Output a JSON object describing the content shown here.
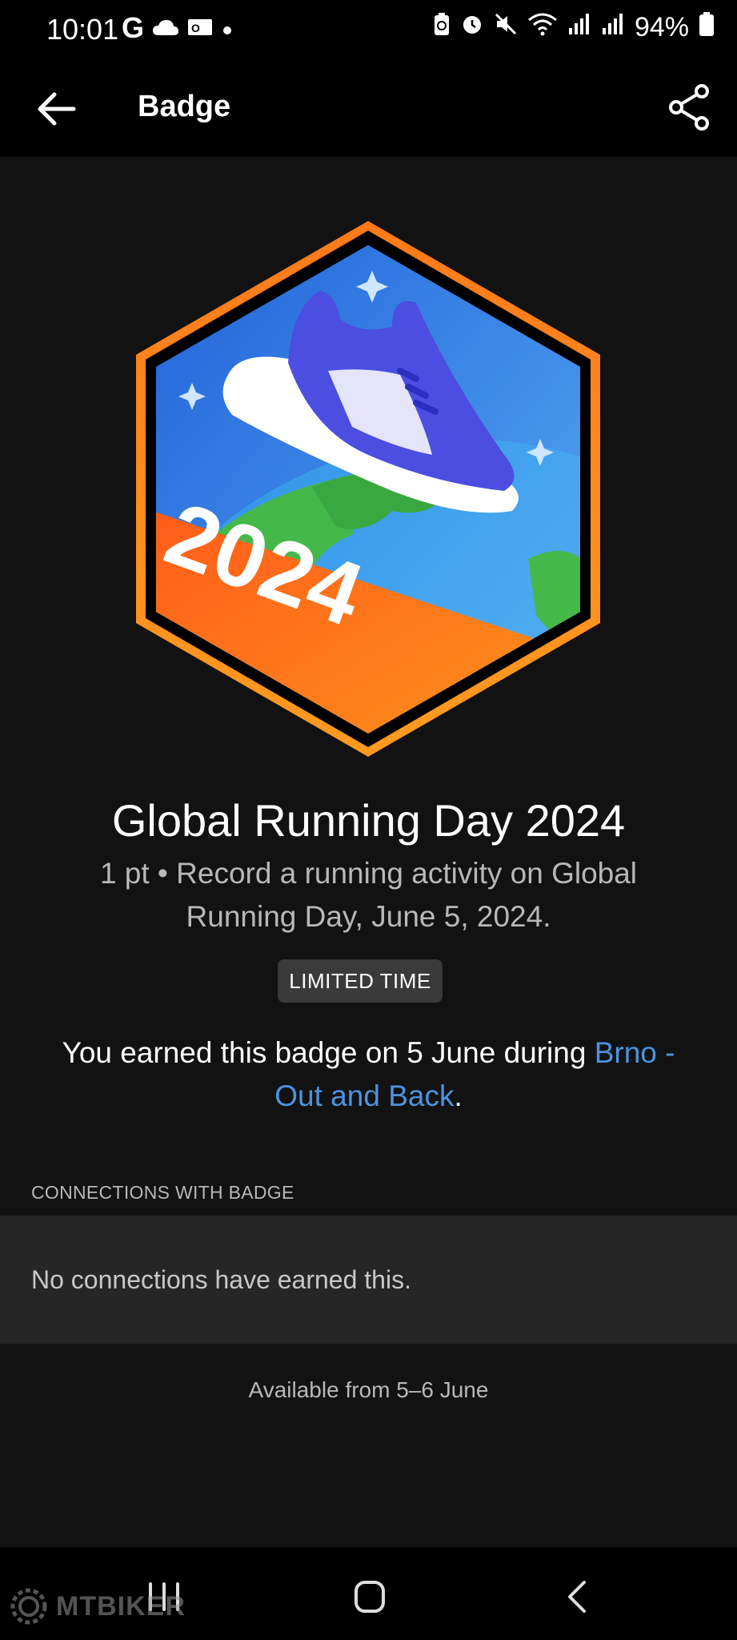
{
  "status_bar": {
    "time": "10:01",
    "left_icons": [
      "google-icon",
      "cloud-icon",
      "outlook-icon",
      "dot-icon"
    ],
    "battery": "94%",
    "right_icons": [
      "battery-saver-icon",
      "alarm-icon",
      "mute-icon",
      "wifi-icon",
      "signal-icon",
      "signal-icon",
      "battery-icon"
    ]
  },
  "app_bar": {
    "title": "Badge",
    "back_icon": "arrow-left-icon",
    "share_icon": "share-icon"
  },
  "badge": {
    "year_label": "2024",
    "colors": {
      "frame": "#ff6a1a",
      "sky": "#2f74e8",
      "ocean": "#3fa9f0",
      "land": "#45b84a",
      "shoe": "#4b4ee0",
      "ribbon": "#ff6a1a"
    }
  },
  "title": "Global Running Day 2024",
  "subtitle": "1 pt • Record a running activity on Global Running Day, June 5, 2024.",
  "pill_label": "LIMITED TIME",
  "earned": {
    "prefix": "You earned this badge on 5 June during ",
    "link": "Brno - Out and Back",
    "suffix": ".",
    "link_color": "#4c93e0"
  },
  "connections": {
    "section_label": "CONNECTIONS WITH BADGE",
    "empty_text": "No connections have earned this."
  },
  "availability": "Available from 5–6 June",
  "nav_bar": {
    "icons": [
      "recents-icon",
      "home-icon",
      "back-icon"
    ]
  },
  "watermark": "MTBIKER"
}
